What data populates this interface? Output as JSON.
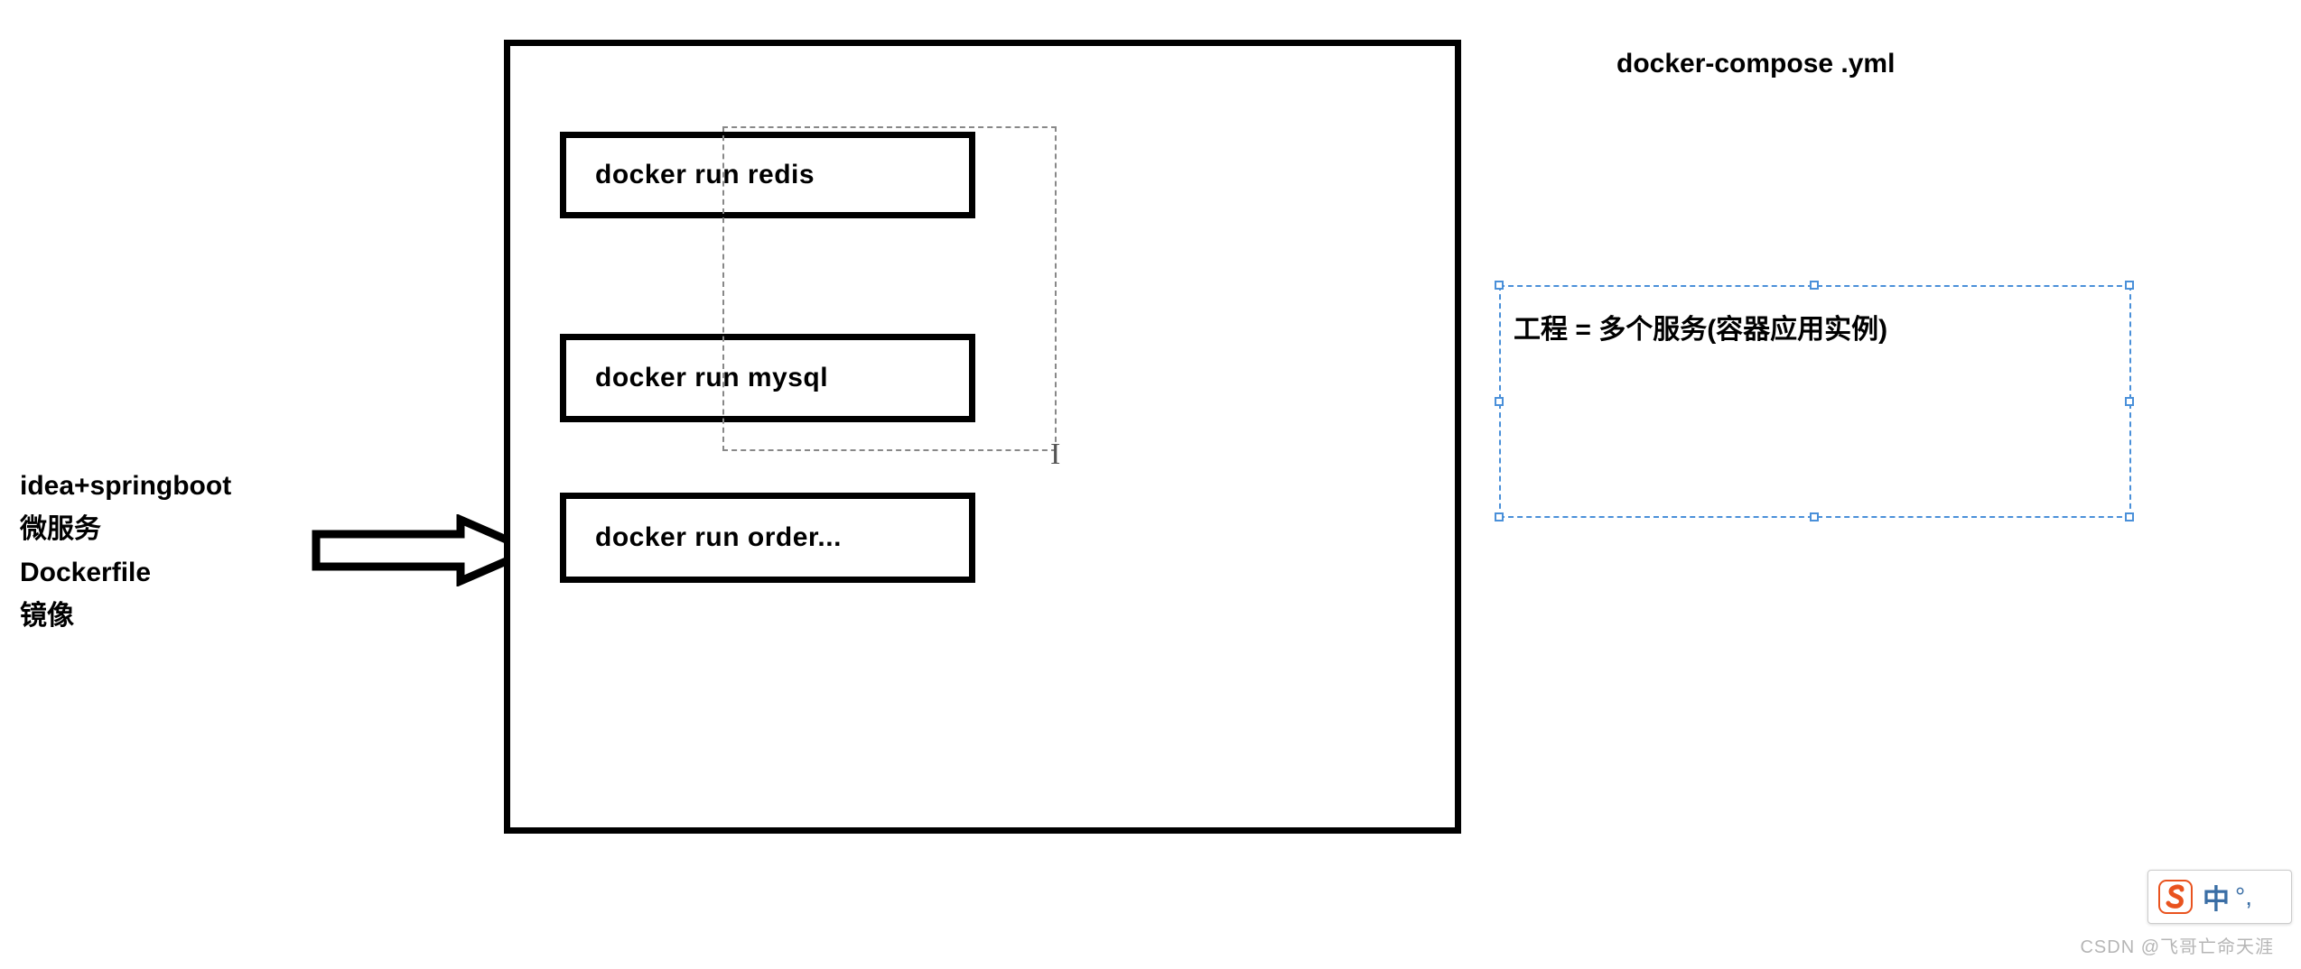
{
  "leftLabels": {
    "line1": "idea+springboot",
    "line2": "微服务",
    "line3": "Dockerfile",
    "line4": "镜像"
  },
  "commands": {
    "redis": "docker run redis",
    "mysql": "docker run   mysql",
    "order": "docker run  order..."
  },
  "composeLabel": "docker-compose .yml",
  "selectionText": "工程 = 多个服务(容器应用实例)",
  "ime": {
    "lang": "中",
    "dots": "°,"
  },
  "watermark": "CSDN @飞哥亡命天涯"
}
